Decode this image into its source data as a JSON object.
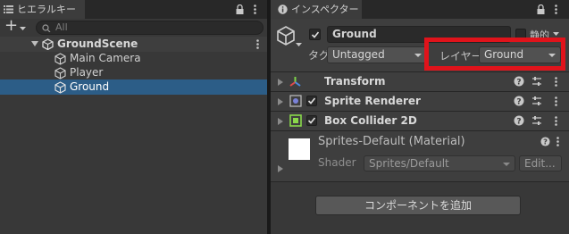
{
  "hierarchy": {
    "tab_label": "ヒエラルキー",
    "add_label": "+",
    "search_placeholder": "All",
    "scene_name": "GroundScene",
    "items": [
      {
        "label": "Main Camera"
      },
      {
        "label": "Player"
      },
      {
        "label": "Ground"
      }
    ]
  },
  "inspector": {
    "tab_label": "インスペクター",
    "object_name": "Ground",
    "static_label": "静的",
    "tag_label": "タグ",
    "tag_value": "Untagged",
    "layer_label": "レイヤー",
    "layer_value": "Ground",
    "components": [
      {
        "label": "Transform"
      },
      {
        "label": "Sprite Renderer"
      },
      {
        "label": "Box Collider 2D"
      }
    ],
    "material": {
      "name": "Sprites-Default (Material)",
      "shader_label": "Shader",
      "shader_value": "Sprites/Default",
      "edit_label": "Edit..."
    },
    "add_component_label": "コンポーネントを追加"
  },
  "colors": {
    "highlight_red": "#e0131b",
    "selection_blue": "#2c5d87",
    "box_collider_green": "#8ad94b"
  }
}
